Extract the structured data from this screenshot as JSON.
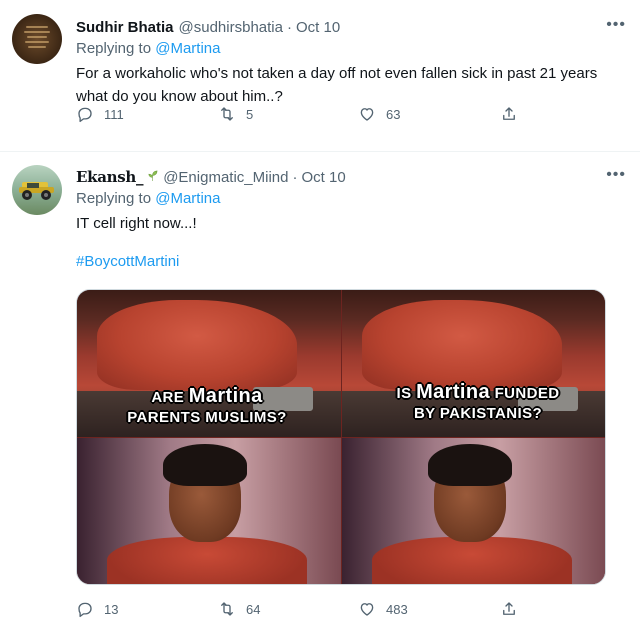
{
  "tweets": [
    {
      "name": "Sudhir Bhatia",
      "handle": "@sudhirsbhatia",
      "date": "Oct 10",
      "replying_prefix": "Replying to ",
      "replying_to": "@Martina",
      "text": "For a workaholic who's not taken a day off not even fallen sick in past 21 years what do you know about him..?",
      "actions": {
        "replies": "111",
        "retweets": "5",
        "likes": "63"
      }
    },
    {
      "name": "Ekansh_",
      "handle": "@Enigmatic_Miind",
      "date": "Oct 10",
      "replying_prefix": "Replying to ",
      "replying_to": "@Martina",
      "text": "IT cell right now...!",
      "hashtag": "#BoycottMartini",
      "meme": {
        "left_caption_1_pre": "ARE ",
        "left_caption_1_big": "Martina",
        "left_caption_2": "PARENTS MUSLIMS?",
        "right_caption_1_pre": "IS ",
        "right_caption_1_big": "Martina",
        "right_caption_1_post": " FUNDED",
        "right_caption_2": "BY PAKISTANIS?"
      },
      "actions": {
        "replies": "13",
        "retweets": "64",
        "likes": "483"
      }
    }
  ],
  "separator": "·",
  "more_glyph": "•••",
  "icons": [
    "reply-icon",
    "retweet-icon",
    "like-icon",
    "share-icon",
    "more-icon",
    "plant-emoji-icon"
  ],
  "colors": {
    "link": "#1d9bf0",
    "secondary": "#536471",
    "text": "#0f1419"
  }
}
